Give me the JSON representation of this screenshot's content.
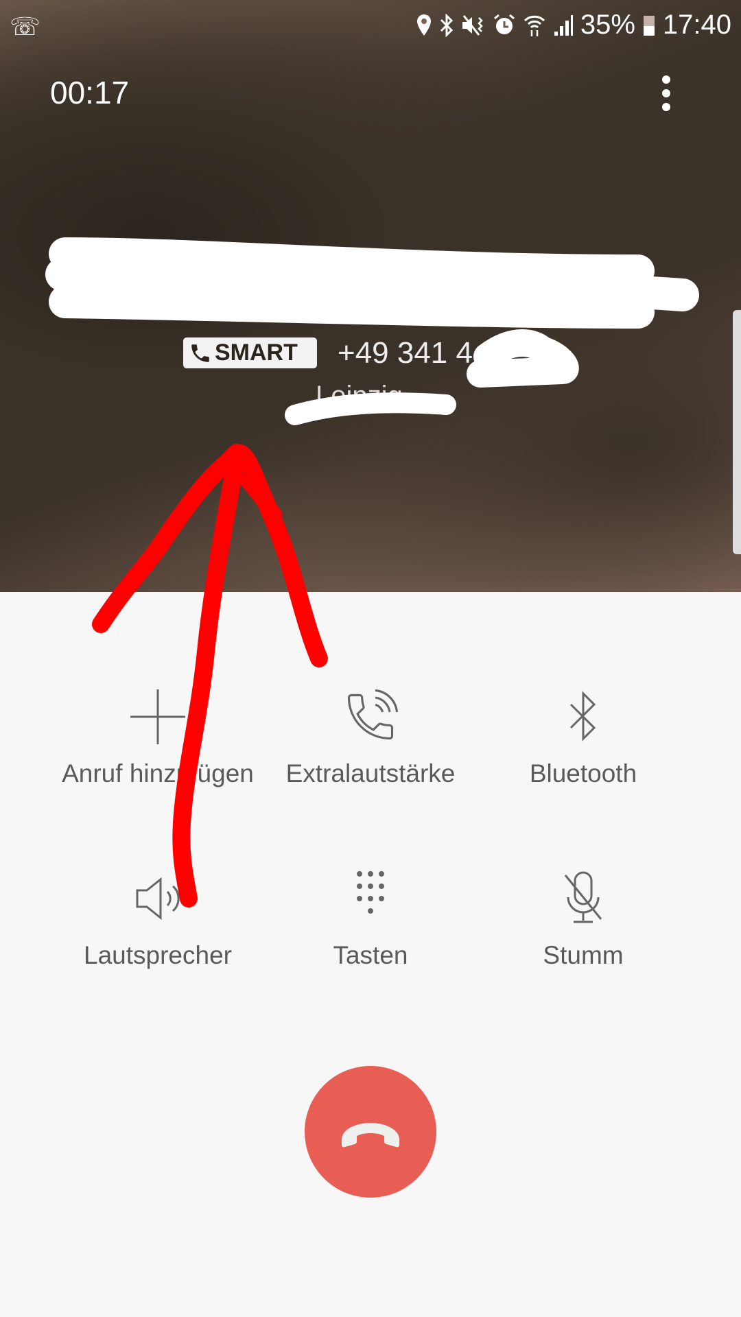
{
  "status_bar": {
    "time": "17:40",
    "battery": "35%",
    "icons": [
      "phone-icon",
      "location-icon",
      "bluetooth-icon",
      "mute-vibrate-icon",
      "alarm-icon",
      "wifi-icon",
      "signal-icon",
      "battery-icon"
    ]
  },
  "call": {
    "duration": "00:17",
    "badge_label": "SMART",
    "number_visible": "+49 341 4",
    "location_partial": "Leipzig"
  },
  "actions": [
    {
      "label": "Anruf hinzufügen",
      "icon": "add-call-icon"
    },
    {
      "label": "Extralautstärke",
      "icon": "extra-volume-icon"
    },
    {
      "label": "Bluetooth",
      "icon": "bluetooth-icon"
    },
    {
      "label": "Lautsprecher",
      "icon": "speaker-icon"
    },
    {
      "label": "Tasten",
      "icon": "keypad-icon"
    },
    {
      "label": "Stumm",
      "icon": "mute-mic-icon"
    }
  ],
  "end_call": {
    "icon": "end-call-icon",
    "color": "#e85d54"
  },
  "annotation": {
    "arrow_color": "#ff0000",
    "redaction_color": "#ffffff"
  }
}
